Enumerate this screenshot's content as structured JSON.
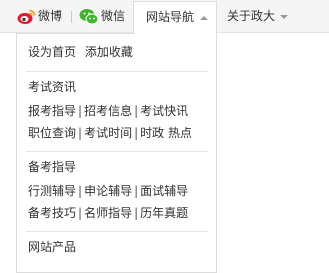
{
  "topnav": {
    "weibo": "微博",
    "wechat": "微信",
    "site_nav": "网站导航",
    "about": "关于政大"
  },
  "dropdown": {
    "top_links": [
      "设为首页",
      "添加收藏"
    ],
    "sections": [
      {
        "title": "考试资讯",
        "rows": [
          [
            "报考指导",
            "招考信息",
            "考试快讯"
          ],
          [
            "职位查询",
            "考试时间",
            "时政 热点"
          ]
        ]
      },
      {
        "title": "备考指导",
        "rows": [
          [
            "行测辅导",
            "申论辅导",
            "面试辅导"
          ],
          [
            "备考技巧",
            "名师指导",
            "历年真题"
          ]
        ]
      },
      {
        "title": "网站产品",
        "rows": []
      }
    ]
  },
  "colors": {
    "topbar_bg": "#f5f5f5",
    "weibo_red": "#e6162d",
    "wechat_green": "#3fb52c",
    "border": "#dcdcdc"
  }
}
